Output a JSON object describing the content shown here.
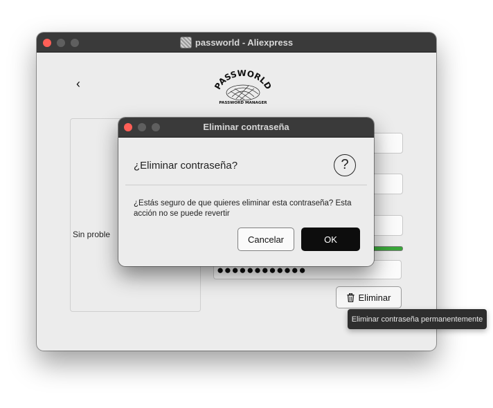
{
  "window": {
    "title": "passworld - Aliexpress"
  },
  "logo": {
    "brand_text": "PASSWORLD",
    "tagline": "PASSWORD MANAGER"
  },
  "back_label": "‹",
  "side_panel": {
    "status_text": "Sin proble"
  },
  "password_field": {
    "masked_value": "●●●●●●●●●●●●"
  },
  "delete_button": {
    "label": "Eliminar"
  },
  "tooltip": {
    "text": "Eliminar contraseña permanentemente"
  },
  "dialog": {
    "title": "Eliminar contraseña",
    "heading": "¿Eliminar contraseña?",
    "question_glyph": "?",
    "message": "¿Estás seguro de que quieres eliminar esta contraseña? Esta acción no se puede revertir",
    "cancel_label": "Cancelar",
    "ok_label": "OK"
  },
  "colors": {
    "close_button": "#ff5f57",
    "strength_bar": "#3aa63a",
    "ok_button": "#0d0d0d"
  }
}
